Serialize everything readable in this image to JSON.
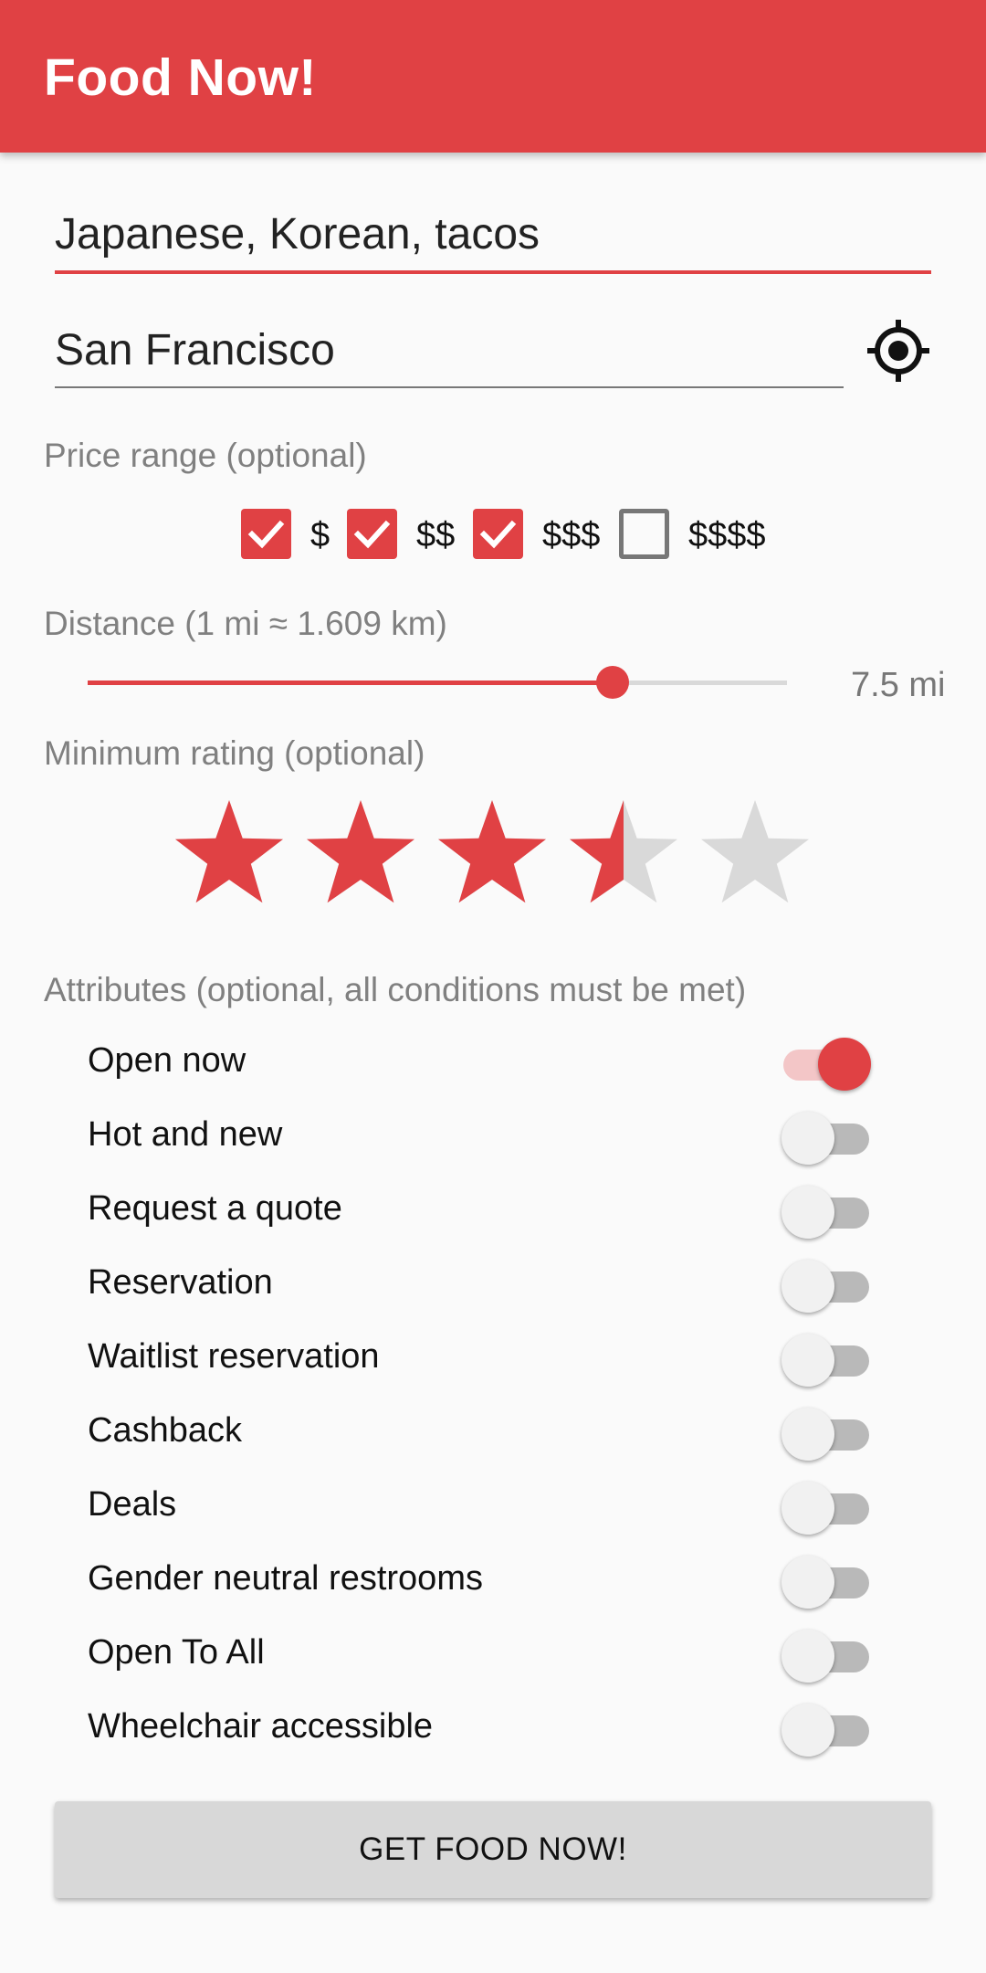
{
  "app": {
    "title": "Food Now!"
  },
  "search": {
    "food_value": "Japanese, Korean, tacos",
    "location_value": "San Francisco",
    "location_icon": "my-location-icon"
  },
  "price": {
    "label": "Price range (optional)",
    "options": [
      {
        "label": "$",
        "checked": true
      },
      {
        "label": "$$",
        "checked": true
      },
      {
        "label": "$$$",
        "checked": true
      },
      {
        "label": "$$$$",
        "checked": false
      }
    ]
  },
  "distance": {
    "label": "Distance (1 mi ≈ 1.609 km)",
    "value_text": "7.5 mi",
    "slider_fraction": 0.75
  },
  "rating": {
    "label": "Minimum rating (optional)",
    "value": 3.5,
    "max": 5
  },
  "attributes": {
    "label": "Attributes (optional, all conditions must be met)",
    "items": [
      {
        "label": "Open now",
        "on": true
      },
      {
        "label": "Hot and new",
        "on": false
      },
      {
        "label": "Request a quote",
        "on": false
      },
      {
        "label": "Reservation",
        "on": false
      },
      {
        "label": "Waitlist reservation",
        "on": false
      },
      {
        "label": "Cashback",
        "on": false
      },
      {
        "label": "Deals",
        "on": false
      },
      {
        "label": "Gender neutral restrooms",
        "on": false
      },
      {
        "label": "Open To All",
        "on": false
      },
      {
        "label": "Wheelchair accessible",
        "on": false
      }
    ]
  },
  "action": {
    "button_label": "GET FOOD NOW!"
  },
  "colors": {
    "accent": "#e04144",
    "inactive": "#d9d9d9",
    "muted_text": "#808080"
  }
}
